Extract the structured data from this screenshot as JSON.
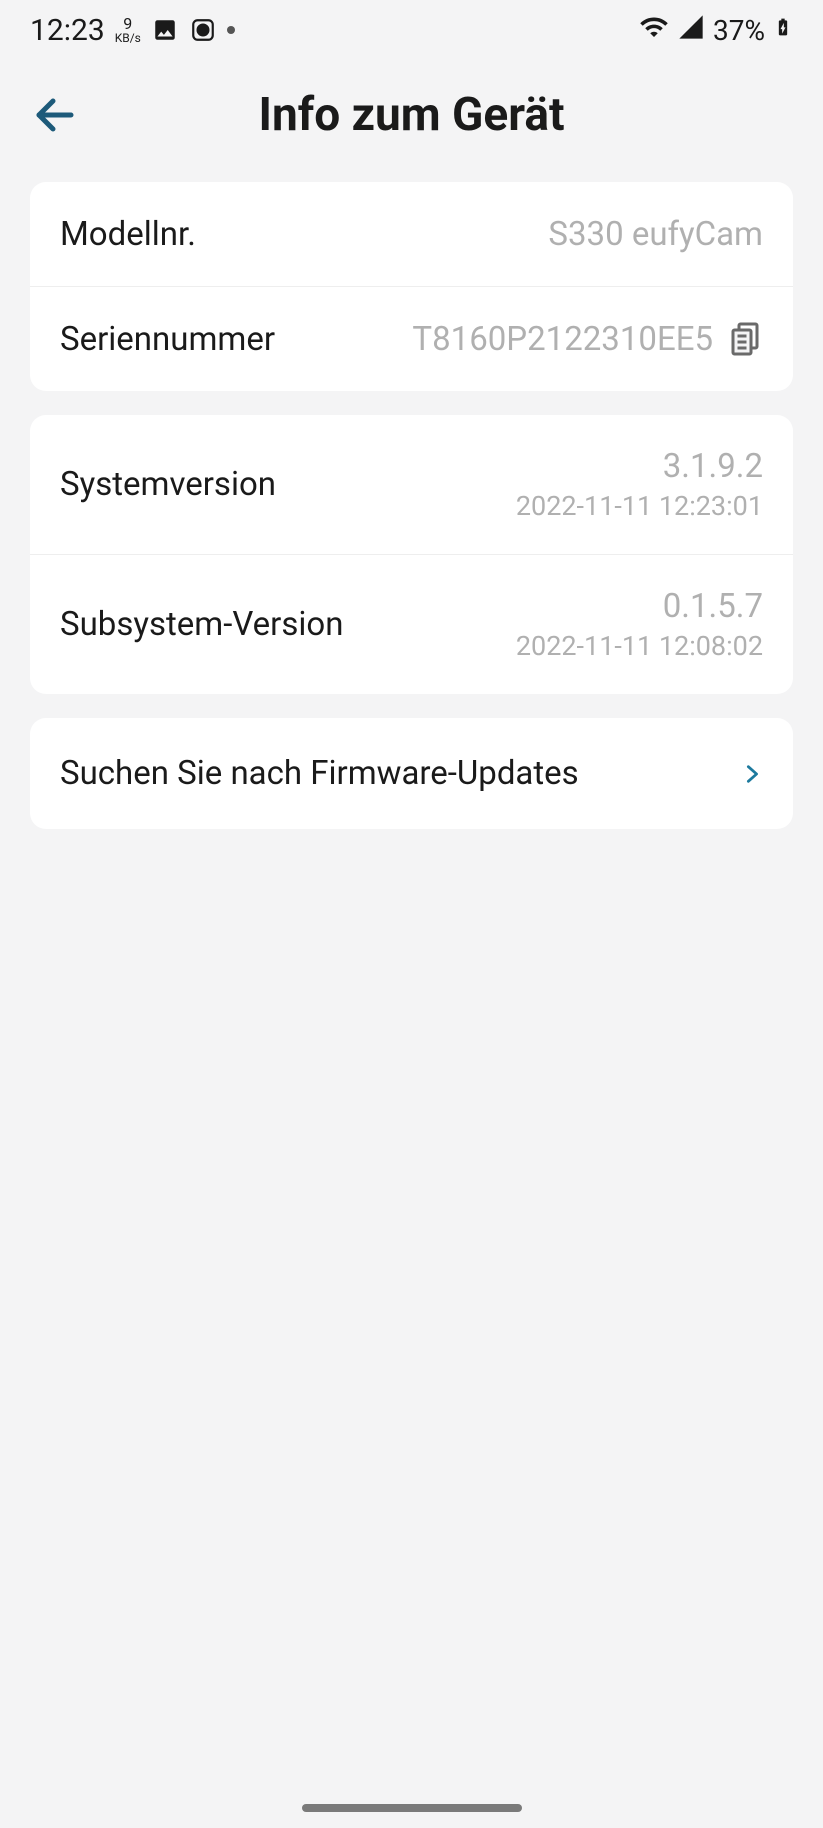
{
  "status_bar": {
    "time": "12:23",
    "kbs_top": "9",
    "kbs_bot": "KB/s",
    "battery_text": "37%"
  },
  "header": {
    "title": "Info zum Gerät"
  },
  "card1": {
    "model_label": "Modellnr.",
    "model_value": "S330 eufyCam",
    "serial_label": "Seriennummer",
    "serial_value": "T8160P2122310EE5"
  },
  "card2": {
    "system_label": "Systemversion",
    "system_value": "3.1.9.2",
    "system_date": "2022-11-11 12:23:01",
    "subsystem_label": "Subsystem-Version",
    "subsystem_value": "0.1.5.7",
    "subsystem_date": "2022-11-11 12:08:02"
  },
  "card3": {
    "firmware_label": "Suchen Sie nach Firmware-Updates"
  }
}
